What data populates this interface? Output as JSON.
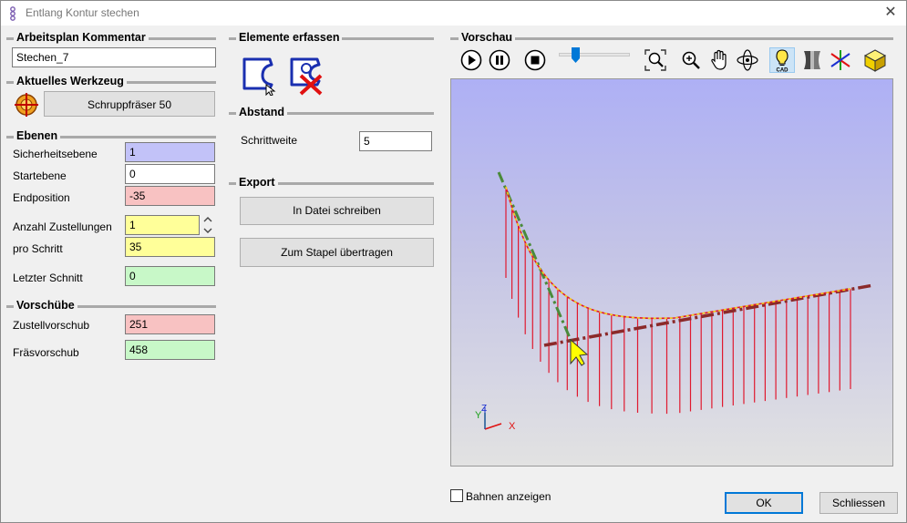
{
  "window": {
    "title": "Entlang Kontur stechen",
    "close_glyph": "✕"
  },
  "plan": {
    "heading": "Arbeitsplan Kommentar",
    "comment_value": "Stechen_7"
  },
  "tool": {
    "heading": "Aktuelles Werkzeug",
    "tool_button": "Schruppfräser 50",
    "icon": "tool-crosshair-icon"
  },
  "levels": {
    "heading": "Ebenen",
    "safety_label": "Sicherheitsebene",
    "safety_value": "1",
    "start_label": "Startebene",
    "start_value": "0",
    "end_label": "Endposition",
    "end_value": "-35",
    "infeeds_label": "Anzahl Zustellungen",
    "infeeds_value": "1",
    "per_step_label": "pro Schritt",
    "per_step_value": "35",
    "last_cut_label": "Letzter Schnitt",
    "last_cut_value": "0"
  },
  "feeds": {
    "heading": "Vorschübe",
    "infeed_label": "Zustellvorschub",
    "infeed_value": "251",
    "mill_label": "Fräsvorschub",
    "mill_value": "458"
  },
  "elements": {
    "heading": "Elemente erfassen",
    "select_icon": "contour-select-icon",
    "delete_icon": "contour-delete-icon"
  },
  "spacing": {
    "heading": "Abstand",
    "step_label": "Schrittweite",
    "step_value": "5"
  },
  "export": {
    "heading": "Export",
    "write_file": "In Datei schreiben",
    "to_batch": "Zum Stapel übertragen"
  },
  "preview": {
    "heading": "Vorschau",
    "slider_level": 0.08,
    "toolbar": [
      "play-icon",
      "pause-icon",
      "stop-icon",
      "zoom-fit-icon",
      "zoom-icon",
      "pan-hand-icon",
      "rotate-icon",
      "light-cad-icon",
      "shading-icon",
      "axes-icon",
      "solid-cube-icon"
    ],
    "axis_labels": {
      "x": "X",
      "y": "Y",
      "z": "Z"
    },
    "colors": {
      "toolpath": "#e0192f",
      "contour": "#f2d21e",
      "center_axis": "#4a8a3a",
      "base_axis": "#8b2a2a"
    }
  },
  "footer": {
    "show_paths_label": "Bahnen anzeigen",
    "show_paths_checked": false,
    "ok": "OK",
    "close": "Schliessen"
  }
}
